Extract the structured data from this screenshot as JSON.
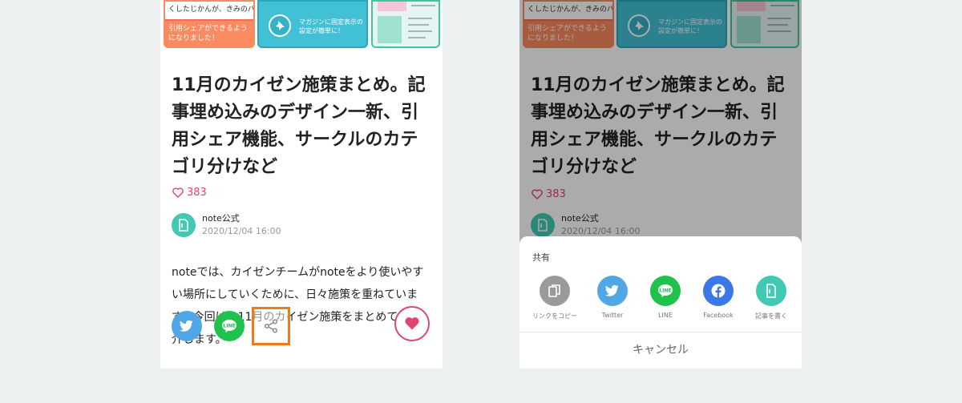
{
  "article": {
    "thumb_left_text": "くしたじかんが、きみのバラ",
    "thumb_left_caption": "引用シェアができるようになりました！",
    "thumb_mid_caption": "マガジンに固定表示の設定が簡単に！",
    "title": "11月のカイゼン施策まとめ。記事埋め込みのデザイン一新、引用シェア機能、サークルのカテゴリ分けなど",
    "likes": "383",
    "author_name": "note公式",
    "author_date": "2020/12/04 16:00",
    "body_text": "noteでは、カイゼンチームがnoteをより使いやすい場所にしていくために、日々施策を重ねています。今回は、11月のカイゼン施策をまとめてご紹介します。"
  },
  "colors": {
    "accent_like": "#e0456b",
    "twitter": "#4fa7e6",
    "line": "#1fc24b",
    "facebook": "#3b78e7",
    "note_green": "#41c9b4",
    "highlight": "#ee7a1b"
  },
  "share_sheet": {
    "title": "共有",
    "options": [
      {
        "label": "リンクをコピー",
        "icon": "copy-icon",
        "color": "#9a9a9a"
      },
      {
        "label": "Twitter",
        "icon": "twitter-icon",
        "color": "#4fa7e6"
      },
      {
        "label": "LINE",
        "icon": "line-icon",
        "color": "#1fc24b"
      },
      {
        "label": "Facebook",
        "icon": "facebook-icon",
        "color": "#3b78e7"
      },
      {
        "label": "記事を書く",
        "icon": "note-icon",
        "color": "#41c9b4"
      }
    ],
    "cancel": "キャンセル"
  }
}
